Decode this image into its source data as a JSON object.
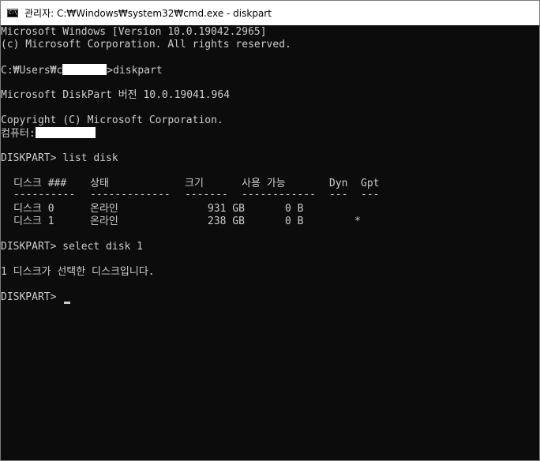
{
  "window": {
    "title": "관리자: C:₩Windows₩system32₩cmd.exe - diskpart",
    "icon": "cmd-icon"
  },
  "console": {
    "version_line": "Microsoft Windows [Version 10.0.19042.2965]",
    "copyright_line": "(c) Microsoft Corporation. All rights reserved.",
    "prompt_prefix": "C:₩Users₩c",
    "prompt_suffix": ">diskpart",
    "diskpart_version": "Microsoft DiskPart 버전 10.0.19041.964",
    "diskpart_copyright": "Copyright (C) Microsoft Corporation.",
    "computer_label": "컴퓨터:",
    "command1": "DISKPART> list disk",
    "table": {
      "headers": [
        "디스크 ###",
        "상태",
        "크기",
        "사용 가능",
        "Dyn",
        "Gpt"
      ],
      "separators": [
        "----------",
        "-------------",
        "-------",
        "------------",
        "---",
        "---"
      ],
      "rows": [
        {
          "disk": "디스크 0",
          "status": "온라인",
          "size": "931 GB",
          "free": "0 B",
          "dyn": "",
          "gpt": ""
        },
        {
          "disk": "디스크 1",
          "status": "온라인",
          "size": "238 GB",
          "free": "0 B",
          "dyn": "",
          "gpt": "*"
        }
      ]
    },
    "command2": "DISKPART> select disk 1",
    "selected_message": "1 디스크가 선택한 디스크입니다.",
    "current_prompt": "DISKPART> "
  },
  "colors": {
    "console_bg": "#0c0c0c",
    "console_fg": "#cccccc",
    "titlebar_bg": "#ffffff"
  }
}
